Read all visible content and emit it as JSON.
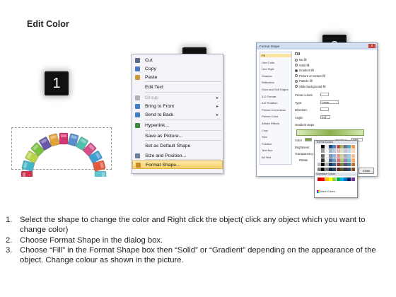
{
  "slide": {
    "title": "Edit Color",
    "steps": [
      "1",
      "2",
      "3"
    ]
  },
  "context_menu": {
    "items": [
      {
        "label": "Cut",
        "icon": "scissors-icon",
        "disabled": false,
        "submenu": false,
        "highlight": false
      },
      {
        "label": "Copy",
        "icon": "copy-icon",
        "disabled": false,
        "submenu": false,
        "highlight": false
      },
      {
        "label": "Paste",
        "icon": "paste-icon",
        "disabled": false,
        "submenu": false,
        "highlight": false
      },
      {
        "label": "Edit Text",
        "icon": "",
        "disabled": false,
        "submenu": false,
        "highlight": false
      },
      {
        "label": "Group",
        "icon": "group-icon",
        "disabled": true,
        "submenu": true,
        "highlight": false
      },
      {
        "label": "Bring to Front",
        "icon": "bring-front-icon",
        "disabled": false,
        "submenu": true,
        "highlight": false
      },
      {
        "label": "Send to Back",
        "icon": "send-back-icon",
        "disabled": false,
        "submenu": true,
        "highlight": false
      },
      {
        "label": "Hyperlink...",
        "icon": "hyperlink-icon",
        "disabled": false,
        "submenu": false,
        "highlight": false
      },
      {
        "label": "Save as Picture...",
        "icon": "",
        "disabled": false,
        "submenu": false,
        "highlight": false
      },
      {
        "label": "Set as Default Shape",
        "icon": "",
        "disabled": false,
        "submenu": false,
        "highlight": false
      },
      {
        "label": "Size and Position...",
        "icon": "size-position-icon",
        "disabled": false,
        "submenu": false,
        "highlight": false
      },
      {
        "label": "Format Shape...",
        "icon": "format-shape-icon",
        "disabled": false,
        "submenu": false,
        "highlight": true
      }
    ]
  },
  "format_dialog": {
    "title": "Format Shape",
    "close_label": "x",
    "sidebar": [
      "Fill",
      "Line Color",
      "Line Style",
      "Shadow",
      "Reflection",
      "Glow and Soft Edges",
      "3-D Format",
      "3-D Rotation",
      "Picture Corrections",
      "Picture Color",
      "Artistic Effects",
      "Crop",
      "Size",
      "Position",
      "Text Box",
      "Alt Text"
    ],
    "section_title": "Fill",
    "fill_options": [
      {
        "label": "No fill",
        "selected": false
      },
      {
        "label": "Solid fill",
        "selected": false
      },
      {
        "label": "Gradient fill",
        "selected": true
      },
      {
        "label": "Picture or texture fill",
        "selected": false
      },
      {
        "label": "Pattern fill",
        "selected": false
      },
      {
        "label": "Slide background fill",
        "selected": false
      }
    ],
    "preset_colors_label": "Preset colors:",
    "type_label": "Type:",
    "type_value": "Linear",
    "direction_label": "Direction:",
    "angle_label": "Angle:",
    "angle_value": "315°",
    "gradient_stops_label": "Gradient stops",
    "color_label": "Color",
    "position_label": "Position:",
    "position_value": "99%",
    "brightness_label": "Brightness:",
    "transparency_label": "Transparency:",
    "rotate_label": "Rotate",
    "close_button": "Close"
  },
  "palette": {
    "theme_label": "Theme Colors",
    "standard_label": "Standard Colors",
    "more_label": "More Colors...",
    "theme_colors": [
      "#ffffff",
      "#000000",
      "#eeece1",
      "#1f497d",
      "#4f81bd",
      "#c0504d",
      "#9bbb59",
      "#8064a2",
      "#4bacc6",
      "#f79646"
    ],
    "standard_colors": [
      "#c00000",
      "#ff0000",
      "#ffc000",
      "#ffff00",
      "#92d050",
      "#00b050",
      "#00b0f0",
      "#0070c0",
      "#002060",
      "#7030a0"
    ]
  },
  "arch_colors": [
    "#d2344f",
    "#44b4c8",
    "#b9d44b",
    "#7ac143",
    "#6a59a8",
    "#e0a338",
    "#d2366e",
    "#5a8ec8",
    "#4fc0ab",
    "#d24f8a",
    "#3f9fd0",
    "#e3573d",
    "#5ec4d0"
  ],
  "instructions": [
    {
      "num": "1.",
      "text": "Select the shape to change the color and Right click the object( click any object which you want to change color)"
    },
    {
      "num": "2.",
      "text": "Choose Format Shape in the dialog box."
    },
    {
      "num": "3.",
      "text": "Choose “Fill” in the Format Shape box then “Solid” or “Gradient” depending on the appearance of the object. Change colour as shown in the picture."
    }
  ]
}
